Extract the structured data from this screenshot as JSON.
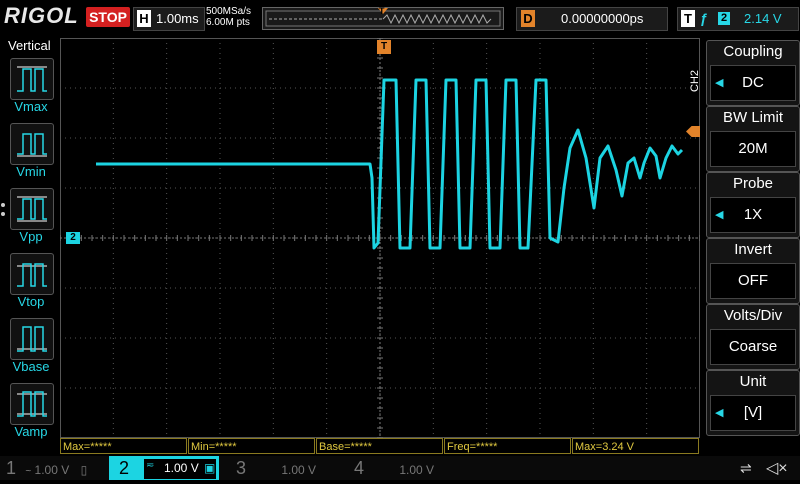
{
  "header": {
    "brand": "RIGOL",
    "run_state": "STOP",
    "horizontal": {
      "key": "H",
      "timebase": "1.00ms"
    },
    "sample_rate": "500MSa/s",
    "memory_depth": "6.00M pts",
    "trigger_marker": "T",
    "delay": {
      "key": "D",
      "value": "0.00000000ps"
    },
    "trigger": {
      "key": "T",
      "source": "2",
      "level": "2.14 V"
    }
  },
  "left_panel": {
    "title": "Vertical",
    "measure_buttons": [
      {
        "label": "Vmax"
      },
      {
        "label": "Vmin"
      },
      {
        "label": "Vpp"
      },
      {
        "label": "Vtop"
      },
      {
        "label": "Vbase"
      },
      {
        "label": "Vamp"
      }
    ]
  },
  "scope": {
    "channel_marker": "2",
    "trigger_position_marker": "T"
  },
  "right_menu": {
    "channel_tag": "CH2",
    "items": [
      {
        "title": "Coupling",
        "value": "DC"
      },
      {
        "title": "BW Limit",
        "value": "20M"
      },
      {
        "title": "Probe",
        "value": "1X"
      },
      {
        "title": "Invert",
        "value": "OFF"
      },
      {
        "title": "Volts/Div",
        "value": "Coarse"
      },
      {
        "title": "Unit",
        "value": "[V]"
      }
    ]
  },
  "measurements": [
    "Max=*****",
    "Min=*****",
    "Base=*****",
    "Freq=*****",
    "Max=3.24 V"
  ],
  "channels": [
    {
      "num": "1",
      "scale": "1.00 V",
      "active": false
    },
    {
      "num": "2",
      "scale": "1.00 V",
      "active": true
    },
    {
      "num": "3",
      "scale": "1.00 V",
      "active": false
    },
    {
      "num": "4",
      "scale": "1.00 V",
      "active": false
    }
  ],
  "colors": {
    "ch2": "#1cd4e2",
    "stop": "#d42020",
    "trigger_orange": "#e2832a",
    "measure_text": "#e0c840"
  }
}
